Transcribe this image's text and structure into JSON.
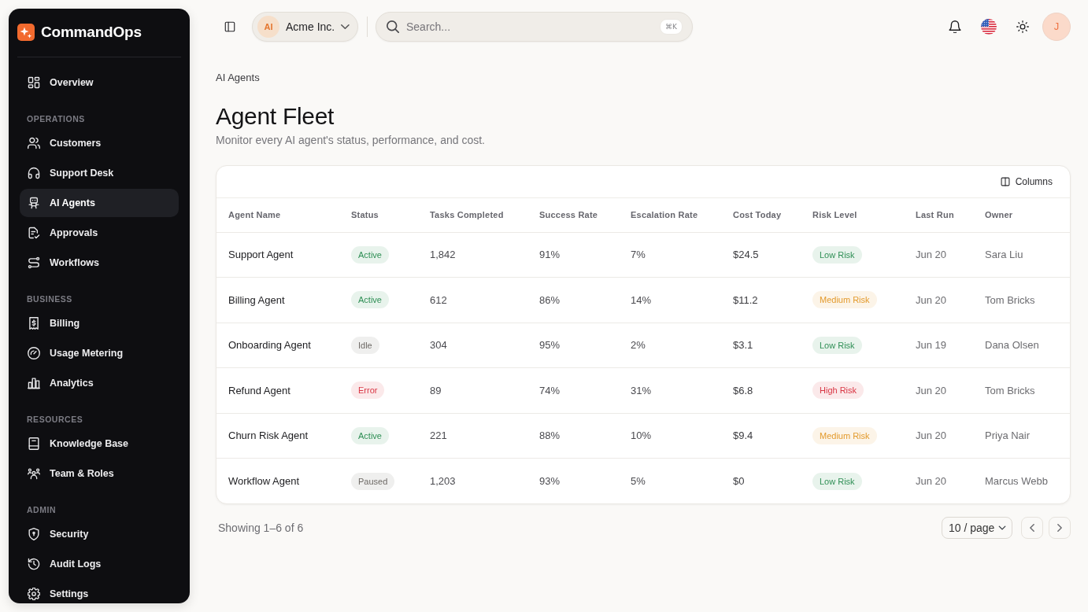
{
  "sidebar": {
    "brand": "CommandOps",
    "sections": [
      {
        "items": [
          {
            "label": "Overview",
            "selected": false
          }
        ]
      },
      {
        "heading": "OPERATIONS",
        "items": [
          {
            "label": "Customers",
            "selected": false
          },
          {
            "label": "Support Desk",
            "selected": false
          },
          {
            "label": "AI Agents",
            "selected": true
          },
          {
            "label": "Approvals",
            "selected": false
          },
          {
            "label": "Workflows",
            "selected": false
          }
        ]
      },
      {
        "heading": "BUSINESS",
        "items": [
          {
            "label": "Billing",
            "selected": false
          },
          {
            "label": "Usage Metering",
            "selected": false
          },
          {
            "label": "Analytics",
            "selected": false
          }
        ]
      },
      {
        "heading": "RESOURCES",
        "items": [
          {
            "label": "Knowledge Base",
            "selected": false
          },
          {
            "label": "Team & Roles",
            "selected": false
          }
        ]
      },
      {
        "heading": "ADMIN",
        "items": [
          {
            "label": "Security",
            "selected": false
          },
          {
            "label": "Audit Logs",
            "selected": false
          },
          {
            "label": "Settings",
            "selected": false
          }
        ]
      }
    ]
  },
  "topbar": {
    "organization": {
      "initials": "AI",
      "name": "Acme Inc."
    },
    "search": {
      "placeholder": "Search...",
      "shortcut": "⌘K"
    },
    "user": {
      "initial": "J"
    }
  },
  "breadcrumb": "AI Agents",
  "page": {
    "title": "Agent Fleet",
    "subtitle": "Monitor every AI agent's status, performance, and cost."
  },
  "table": {
    "toolbar_button": "Columns",
    "columns": [
      "Agent Name",
      "Status",
      "Tasks Completed",
      "Success Rate",
      "Escalation Rate",
      "Cost Today",
      "Risk Level",
      "Last Run",
      "Owner"
    ],
    "rows": [
      {
        "agent_name": "Support Agent",
        "status": {
          "label": "Active",
          "color": "#2f8f55"
        },
        "tasks_completed": "1,842",
        "success_rate": "91%",
        "escalation_rate": "7%",
        "cost_today": "$24.5",
        "risk_level": {
          "label": "Low Risk",
          "color": "#2f8f55"
        },
        "last_run": "Jun 20",
        "owner": "Sara Liu"
      },
      {
        "agent_name": "Billing Agent",
        "status": {
          "label": "Active",
          "color": "#2f8f55"
        },
        "tasks_completed": "612",
        "success_rate": "86%",
        "escalation_rate": "14%",
        "cost_today": "$11.2",
        "risk_level": {
          "label": "Medium Risk",
          "color": "#e39a2c"
        },
        "last_run": "Jun 20",
        "owner": "Tom Bricks"
      },
      {
        "agent_name": "Onboarding Agent",
        "status": {
          "label": "Idle",
          "color": "#6e6a66"
        },
        "tasks_completed": "304",
        "success_rate": "95%",
        "escalation_rate": "2%",
        "cost_today": "$3.1",
        "risk_level": {
          "label": "Low Risk",
          "color": "#2f8f55"
        },
        "last_run": "Jun 19",
        "owner": "Dana Olsen"
      },
      {
        "agent_name": "Refund Agent",
        "status": {
          "label": "Error",
          "color": "#d93644"
        },
        "tasks_completed": "89",
        "success_rate": "74%",
        "escalation_rate": "31%",
        "cost_today": "$6.8",
        "risk_level": {
          "label": "High Risk",
          "color": "#d93644"
        },
        "last_run": "Jun 20",
        "owner": "Tom Bricks"
      },
      {
        "agent_name": "Churn Risk Agent",
        "status": {
          "label": "Active",
          "color": "#2f8f55"
        },
        "tasks_completed": "221",
        "success_rate": "88%",
        "escalation_rate": "10%",
        "cost_today": "$9.4",
        "risk_level": {
          "label": "Medium Risk",
          "color": "#e39a2c"
        },
        "last_run": "Jun 20",
        "owner": "Priya Nair"
      },
      {
        "agent_name": "Workflow Agent",
        "status": {
          "label": "Paused",
          "color": "#6e6a66"
        },
        "tasks_completed": "1,203",
        "success_rate": "93%",
        "escalation_rate": "5%",
        "cost_today": "$0",
        "risk_level": {
          "label": "Low Risk",
          "color": "#2f8f55"
        },
        "last_run": "Jun 20",
        "owner": "Marcus Webb"
      }
    ]
  },
  "pagination": {
    "summary": "Showing 1–6 of 6",
    "page_size": "10 / page"
  }
}
